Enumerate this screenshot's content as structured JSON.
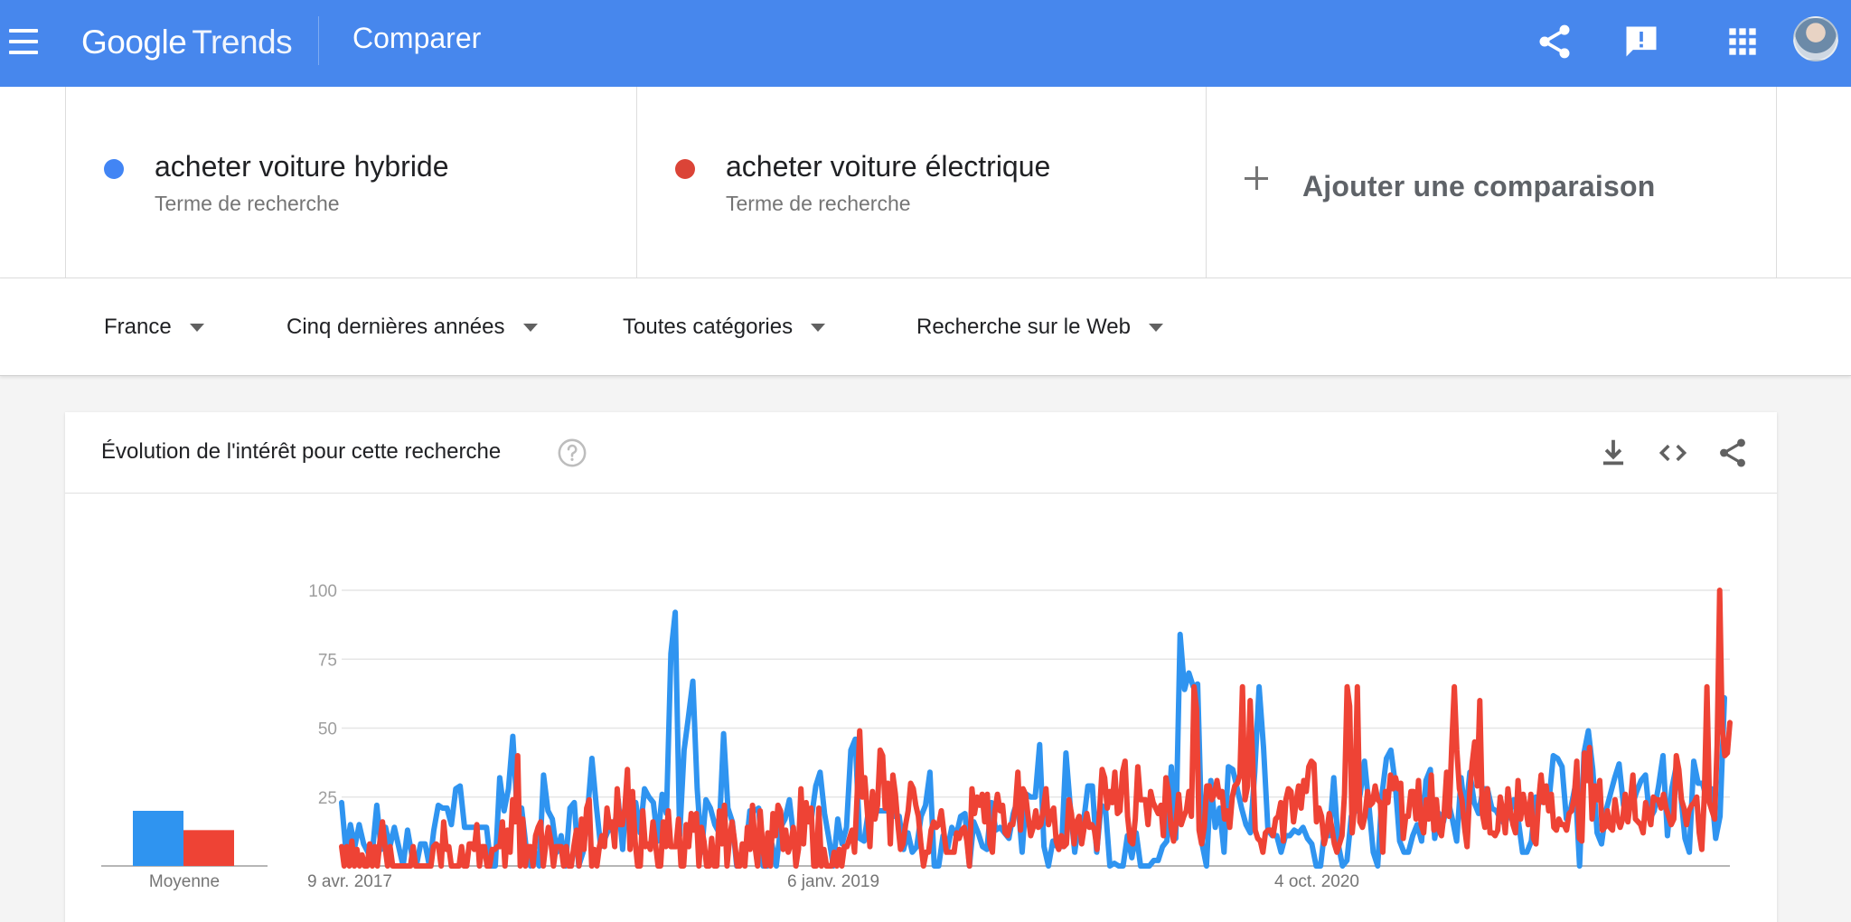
{
  "header": {
    "logo_google": "Google",
    "logo_trends": "Trends",
    "page_title": "Comparer",
    "icons": [
      "menu-icon",
      "share-icon",
      "feedback-icon",
      "apps-icon",
      "avatar"
    ]
  },
  "terms": [
    {
      "name": "acheter voiture hybride",
      "type": "Terme de recherche",
      "color": "#4285f4"
    },
    {
      "name": "acheter voiture électrique",
      "type": "Terme de recherche",
      "color": "#db4437"
    }
  ],
  "add_comparison": "Ajouter une comparaison",
  "filters": {
    "region": "France",
    "period": "Cinq dernières années",
    "category": "Toutes catégories",
    "search_type": "Recherche sur le Web"
  },
  "card": {
    "title": "Évolution de l'intérêt pour cette recherche",
    "icons": [
      "help-icon",
      "download-icon",
      "embed-icon",
      "share-icon"
    ]
  },
  "chart_data": {
    "type": "line",
    "title": "",
    "ylim": [
      0,
      100
    ],
    "yticks": [
      "100",
      "75",
      "50",
      "25"
    ],
    "xticks": [
      "9 avr. 2017",
      "6 janv. 2019",
      "4 oct. 2020"
    ],
    "average": {
      "label": "Moyenne",
      "values": [
        20,
        13
      ]
    },
    "series": [
      {
        "name": "acheter voiture hybride",
        "color": "#2f94f0",
        "values": [
          23,
          5,
          15,
          7,
          15,
          8,
          5,
          5,
          22,
          6,
          14,
          7,
          14,
          7,
          0,
          13,
          4,
          0,
          8,
          8,
          0,
          13,
          22,
          21,
          21,
          15,
          28,
          29,
          14,
          14,
          14,
          14,
          14,
          14,
          0,
          0,
          32,
          20,
          28,
          47,
          19,
          21,
          7,
          0,
          5,
          0,
          33,
          20,
          17,
          5,
          11,
          0,
          21,
          23,
          0,
          5,
          19,
          39,
          22,
          7,
          10,
          14,
          12,
          24,
          6,
          28,
          21,
          23,
          12,
          28,
          25,
          23,
          9,
          26,
          19,
          77,
          92,
          11,
          42,
          54,
          67,
          28,
          5,
          24,
          21,
          15,
          12,
          48,
          21,
          16,
          0,
          4,
          5,
          20,
          20,
          21,
          0,
          0,
          8,
          0,
          14,
          17,
          24,
          10,
          6,
          20,
          21,
          17,
          29,
          34,
          19,
          10,
          0,
          17,
          8,
          14,
          42,
          46,
          10,
          9,
          20,
          20,
          20,
          20,
          20,
          21,
          18,
          18,
          6,
          12,
          5,
          7,
          18,
          22,
          34,
          0,
          0,
          11,
          6,
          14,
          11,
          18,
          19,
          0,
          16,
          12,
          7,
          6,
          23,
          13,
          14,
          12,
          10,
          19,
          24,
          5,
          26,
          25,
          25,
          44,
          7,
          0,
          9,
          7,
          7,
          41,
          21,
          5,
          17,
          16,
          29,
          29,
          5,
          22,
          21,
          0,
          1,
          0,
          0,
          11,
          3,
          12,
          0,
          0,
          0,
          2,
          2,
          7,
          9,
          36,
          10,
          84,
          64,
          70,
          65,
          66,
          8,
          0,
          31,
          14,
          21,
          5,
          36,
          35,
          28,
          21,
          15,
          12,
          34,
          65,
          43,
          13,
          11,
          11,
          5,
          11,
          11,
          13,
          12,
          14,
          10,
          8,
          0,
          0,
          14,
          11,
          32,
          8,
          0,
          2,
          18,
          20,
          26,
          38,
          22,
          5,
          0,
          26,
          39,
          42,
          30,
          9,
          5,
          5,
          11,
          15,
          9,
          31,
          35,
          10,
          19,
          16,
          24,
          17,
          9,
          32,
          18,
          34,
          23,
          19,
          28,
          28,
          21,
          20,
          17,
          15,
          20,
          24,
          17,
          5,
          5,
          9,
          25,
          23,
          26,
          23,
          40,
          39,
          36,
          17,
          21,
          29,
          0,
          41,
          49,
          35,
          12,
          8,
          20,
          26,
          32,
          37,
          22,
          20,
          22,
          27,
          31,
          33,
          17,
          20,
          29,
          40,
          11,
          28,
          36,
          27,
          10,
          5,
          38,
          30,
          30,
          24,
          28,
          10,
          18,
          61
        ]
      },
      {
        "name": "acheter voiture électrique",
        "color": "#ee4335",
        "values": [
          7,
          0,
          7,
          0,
          9,
          0,
          6,
          0,
          4,
          0,
          0,
          8,
          0,
          7,
          0,
          9,
          16,
          7,
          0,
          7,
          0,
          0,
          0,
          0,
          0,
          0,
          0,
          0,
          7,
          0,
          0,
          0,
          0,
          0,
          0,
          0,
          7,
          8,
          7,
          0,
          16,
          6,
          7,
          0,
          0,
          0,
          0,
          7,
          0,
          0,
          8,
          8,
          6,
          15,
          0,
          7,
          7,
          0,
          0,
          6,
          6,
          7,
          7,
          16,
          0,
          13,
          5,
          24,
          16,
          40,
          0,
          17,
          0,
          7,
          7,
          0,
          11,
          14,
          16,
          0,
          8,
          14,
          9,
          0,
          7,
          7,
          7,
          0,
          7,
          0,
          0,
          7,
          13,
          0,
          17,
          6,
          21,
          24,
          0,
          6,
          0,
          7,
          11,
          7,
          21,
          14,
          16,
          7,
          28,
          15,
          15,
          21,
          35,
          6,
          27,
          9,
          0,
          0,
          20,
          7,
          8,
          6,
          16,
          8,
          0,
          0,
          16,
          7,
          20,
          7,
          7,
          7,
          17,
          0,
          0,
          15,
          7,
          19,
          13,
          19,
          0,
          14,
          9,
          0,
          0,
          10,
          0,
          0,
          20,
          8,
          22,
          0,
          10,
          16,
          9,
          0,
          0,
          8,
          0,
          14,
          6,
          22,
          7,
          0,
          20,
          7,
          0,
          12,
          0,
          19,
          11,
          22,
          20,
          6,
          13,
          5,
          8,
          14,
          0,
          6,
          28,
          8,
          23,
          16,
          21,
          0,
          0,
          21,
          0,
          6,
          0,
          0,
          0,
          5,
          0,
          6,
          0,
          7,
          7,
          10,
          13,
          5,
          26,
          49,
          25,
          32,
          20,
          7,
          27,
          17,
          22,
          42,
          40,
          21,
          30,
          8,
          33,
          26,
          15,
          6,
          8,
          15,
          20,
          30,
          28,
          22,
          18,
          8,
          0,
          5,
          5,
          13,
          16,
          14,
          15,
          20,
          12,
          5,
          5,
          5,
          5,
          12,
          10,
          13,
          14,
          9,
          0,
          28,
          19,
          25,
          22,
          26,
          16,
          26,
          8,
          5,
          20,
          26,
          20,
          22,
          12,
          11,
          15,
          15,
          21,
          34,
          13,
          28,
          26,
          18,
          11,
          14,
          20,
          14,
          15,
          21,
          28,
          15,
          19,
          21,
          9,
          6,
          11,
          7,
          8,
          24,
          19,
          8,
          16,
          18,
          8,
          14,
          19,
          14,
          15,
          13,
          6,
          20,
          35,
          32,
          21,
          27,
          23,
          34,
          19,
          20,
          34,
          38,
          18,
          9,
          8,
          17,
          36,
          24,
          24,
          24,
          15,
          27,
          23,
          21,
          19,
          22,
          11,
          32,
          27,
          14,
          9,
          16,
          26,
          15,
          18,
          20,
          27,
          18,
          65,
          57,
          13,
          8,
          14,
          29,
          29,
          24,
          26,
          31,
          25,
          27,
          17,
          20,
          14,
          25,
          29,
          30,
          33,
          65,
          24,
          29,
          60,
          39,
          13,
          10,
          9,
          5,
          12,
          13,
          13,
          11,
          17,
          18,
          23,
          9,
          24,
          28,
          27,
          16,
          23,
          29,
          21,
          31,
          27,
          36,
          38,
          37,
          16,
          21,
          18,
          8,
          12,
          19,
          14,
          8,
          5,
          8,
          11,
          26,
          65,
          58,
          12,
          22,
          65,
          16,
          14,
          18,
          27,
          22,
          23,
          29,
          24,
          23,
          5,
          27,
          23,
          33,
          28,
          32,
          28,
          30,
          10,
          18,
          18,
          27,
          27,
          17,
          31,
          15,
          12,
          24,
          17,
          33,
          13,
          24,
          13,
          11,
          19,
          34,
          18,
          43,
          65,
          42,
          28,
          24,
          14,
          7,
          26,
          37,
          45,
          29,
          60,
          19,
          14,
          28,
          12,
          12,
          11,
          13,
          25,
          20,
          12,
          28,
          20,
          15,
          12,
          31,
          17,
          26,
          21,
          15,
          26,
          10,
          8,
          23,
          33,
          23,
          29,
          20,
          26,
          14,
          13,
          17,
          15,
          15,
          13,
          19,
          20,
          25,
          38,
          10,
          9,
          41,
          31,
          43,
          17,
          29,
          24,
          31,
          13,
          14,
          20,
          14,
          13,
          24,
          17,
          14,
          17,
          26,
          16,
          23,
          33,
          17,
          16,
          15,
          12,
          23,
          19,
          15,
          25,
          24,
          24,
          21,
          26,
          21,
          18,
          15,
          17,
          40,
          35,
          24,
          21,
          15,
          20,
          22,
          23,
          25,
          12,
          6,
          26,
          65,
          23,
          20,
          17,
          44,
          100,
          50,
          40,
          41,
          52
        ]
      }
    ]
  }
}
